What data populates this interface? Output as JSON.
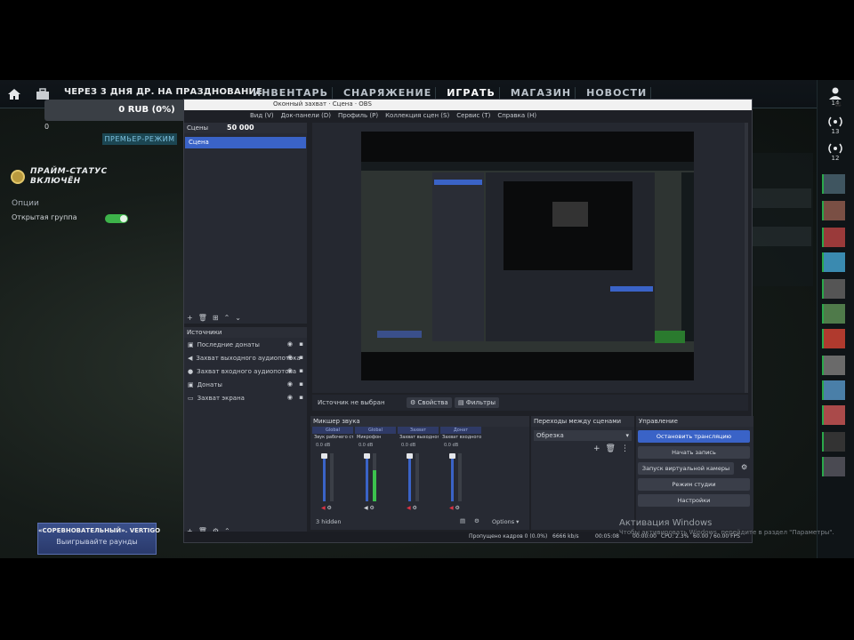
{
  "game": {
    "promo": "ЧЕРЕЗ 3 ДНЯ ДР. НА ПРАЗДНОВАНИЕ",
    "nav": [
      "ИНВЕНТАРЬ",
      "СНАРЯЖЕНИЕ",
      "ИГРАТЬ",
      "МАГАЗИН",
      "НОВОСТИ"
    ],
    "balance": "0 RUB (0%)",
    "zero": "0",
    "premier": "ПРЕМЬЕР-РЕЖИМ",
    "prime_line1": "ПРАЙМ-СТАТУС",
    "prime_line2": "ВКЛЮЧЁН",
    "options_label": "Опции",
    "open_group_label": "Открытая группа",
    "banner_line1": "«СОРЕВНОВАТЕЛЬНЫЙ». VERTIGO",
    "banner_line2": "Выигрывайте раунды",
    "friend_counts": [
      "14",
      "13",
      "12"
    ],
    "activate_title": "Активация Windows",
    "activate_sub": "Чтобы активировать Windows, перейдите в раздел \"Параметры\".",
    "accent_color": "#3db34a"
  },
  "obs": {
    "title": "Оконный захват · Сцена · OBS",
    "menu": [
      "Вид (V)",
      "Док-панели (D)",
      "Профиль (P)",
      "Коллекция сцен (S)",
      "Сервис (T)",
      "Справка (H)"
    ],
    "scenes_header": "Сцены",
    "scene_value": "50 000",
    "scene_selected": "Сцена",
    "sources_header": "Источники",
    "sources": [
      {
        "icon": "image-icon",
        "label": "Последние донаты"
      },
      {
        "icon": "speaker-icon",
        "label": "Захват выходного аудиопотока"
      },
      {
        "icon": "mic-icon",
        "label": "Захват входного аудиопотока"
      },
      {
        "icon": "image-icon",
        "label": "Донаты"
      },
      {
        "icon": "monitor-icon",
        "label": "Захват экрана"
      }
    ],
    "no_source": "Источник не выбран",
    "properties": "Свойства",
    "filters": "Фильтры",
    "mixer_header": "Микшер звука",
    "channels": [
      {
        "head": "Global",
        "device": "Звук рабочего стола",
        "db": "0.0 dB",
        "level": 0.0
      },
      {
        "head": "Global",
        "device": "Микрофон",
        "db": "0.0 dB",
        "level": 0.65
      },
      {
        "head": "Захват",
        "device": "Захват выходного",
        "db": "0.0 dB",
        "level": 0.0
      },
      {
        "head": "Донат",
        "device": "Захват входного",
        "db": "0.0 dB",
        "level": 0.0
      }
    ],
    "hidden": "3 hidden",
    "options_btn": "Options",
    "transitions_header": "Переходы между сценами",
    "transition_value": "Обрезка",
    "controls_header": "Управление",
    "controls": [
      "Остановить трансляцию",
      "Начать запись",
      "Запуск виртуальной камеры",
      "Режим студии",
      "Настройки"
    ],
    "status": {
      "dropped": "Пропущено кадров 0 (0.0%)",
      "bitrate": "6666 kb/s",
      "live_time": "00:05:08",
      "rec_time": "00:00:00",
      "cpu": "CPU: 2.3%",
      "fps": "60.00 / 60.00 FPS"
    }
  }
}
